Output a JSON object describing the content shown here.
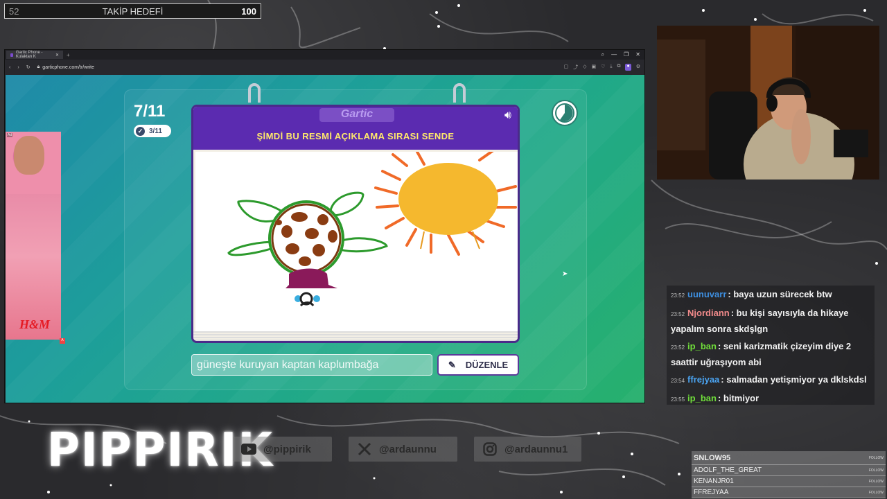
{
  "goal": {
    "current": "52",
    "title": "TAKİP HEDEFİ",
    "target": "100"
  },
  "browser": {
    "tab_title": "Gartic Phone - Kulaktan K",
    "url": "garticphone.com/tr/write"
  },
  "ad": {
    "label": "Ad",
    "brand": "H&M",
    "badge": "A"
  },
  "game": {
    "round": "7/11",
    "done": "3/11",
    "logo": "Gartic",
    "prompt": "ŞİMDİ BU RESMİ AÇIKLAMA SIRASI SENDE",
    "answer_value": "güneşte kuruyan kaptan kaplumbağa",
    "edit_button": "DÜZENLE"
  },
  "chat": [
    {
      "time": "23:52",
      "user": "uunuvarr",
      "color": "#3e8fe0",
      "text": "baya uzun sürecek btw"
    },
    {
      "time": "23:52",
      "user": "Njordiann",
      "color": "#f08a8a",
      "text": "bu kişi sayısıyla da hikaye yapalım sonra skdşlgn"
    },
    {
      "time": "23:52",
      "user": "ip_ban",
      "color": "#6fdc3a",
      "text": "seni karizmatik çizeyim diye 2 saattir uğraşıyom abi"
    },
    {
      "time": "23:54",
      "user": "ffrejyaa",
      "color": "#4aa3f0",
      "text": "salmadan yetişmiyor ya dklskdsl"
    },
    {
      "time": "23:55",
      "user": "ip_ban",
      "color": "#6fdc3a",
      "text": "bitmiyor"
    }
  ],
  "branding": {
    "name": "PIPPIRIK"
  },
  "socials": [
    {
      "icon": "youtube-icon",
      "handle": "@pippirik"
    },
    {
      "icon": "x-icon",
      "handle": "@ardaunnu"
    },
    {
      "icon": "instagram-icon",
      "handle": "@ardaunnu1"
    }
  ],
  "followers": {
    "follow_label": "FOLLOW",
    "names": [
      "SNLOW95",
      "ADOLF_THE_GREAT",
      "KENANJR01",
      "FFREJYAA"
    ]
  }
}
